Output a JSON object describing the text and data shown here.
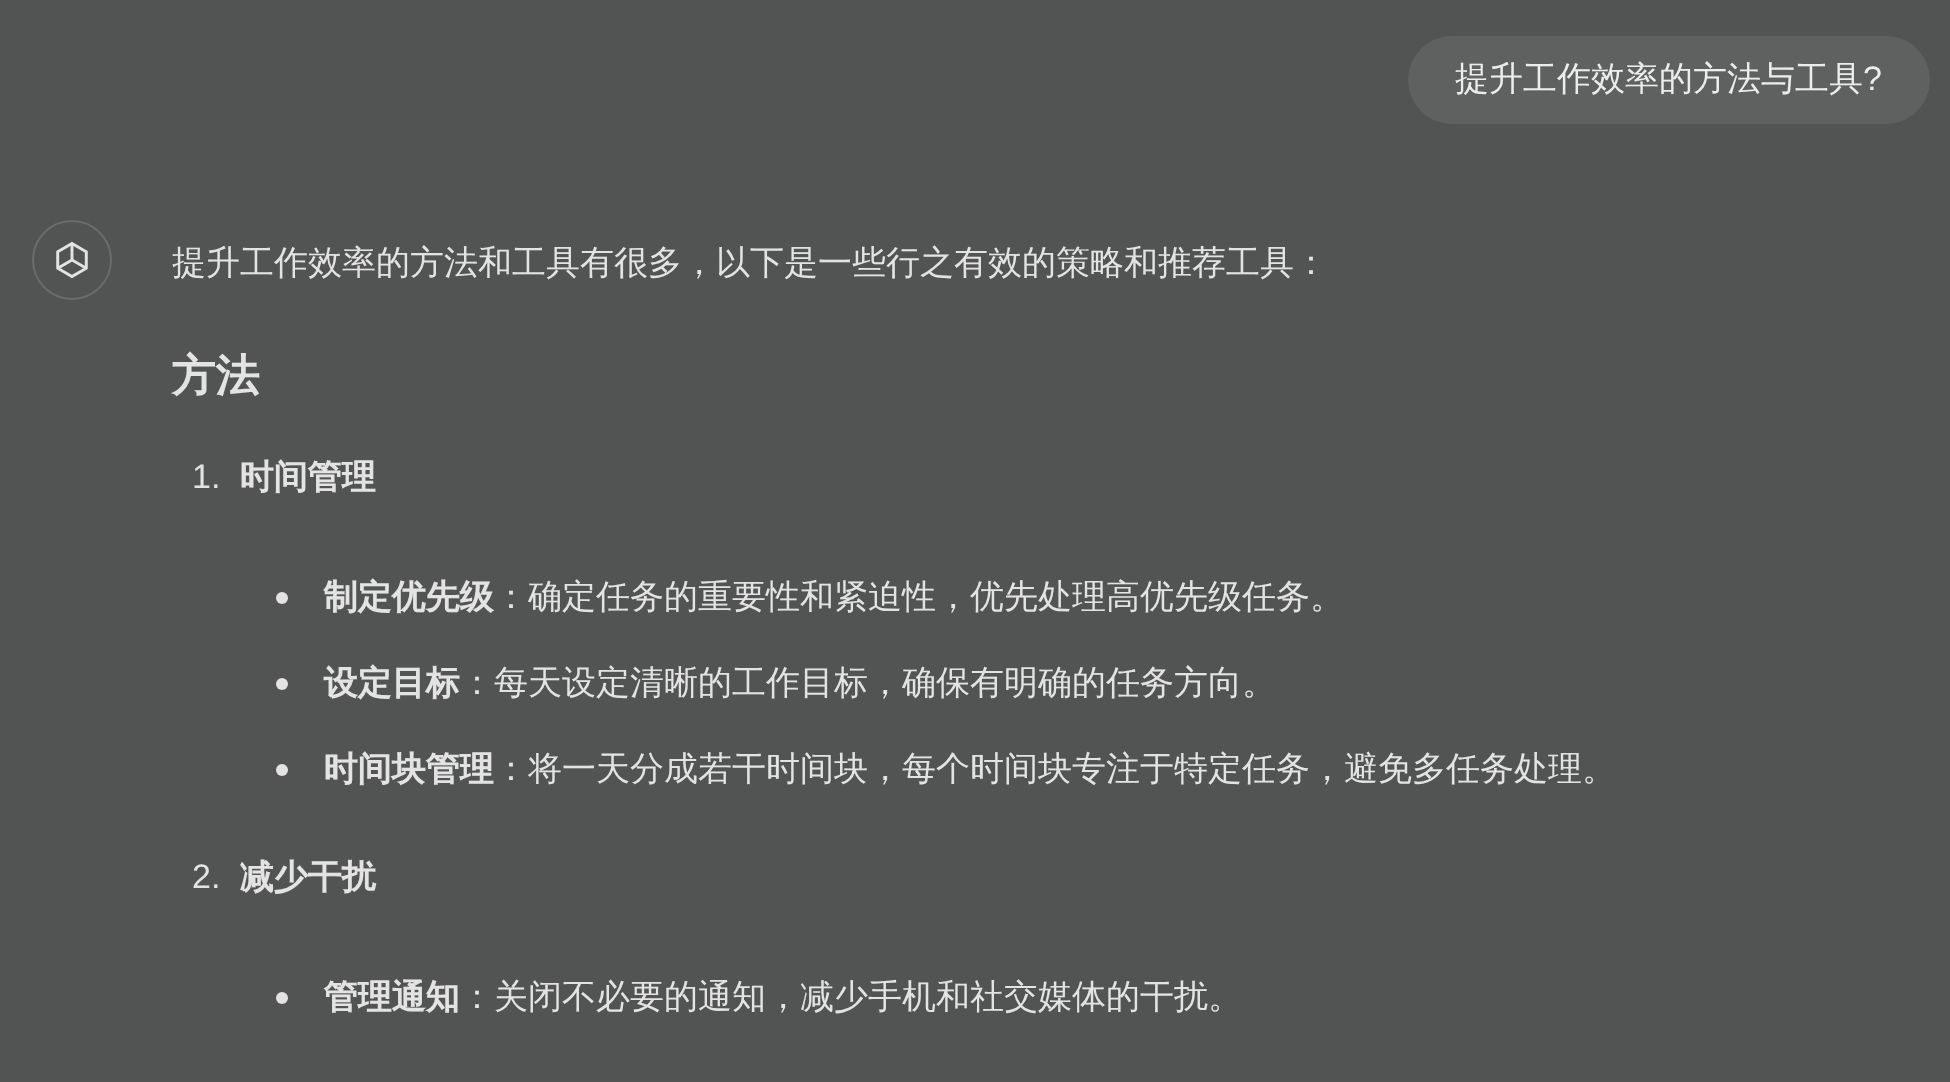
{
  "user_message": "提升工作效率的方法与工具?",
  "assistant": {
    "intro": "提升工作效率的方法和工具有很多，以下是一些行之有效的策略和推荐工具：",
    "sections": [
      {
        "heading": "方法",
        "items": [
          {
            "number": "1.",
            "title": "时间管理",
            "bullets": [
              "**制定优先级**：确定任务的重要性和紧迫性，优先处理高优先级任务。",
              "**设定目标**：每天设定清晰的工作目标，确保有明确的任务方向。",
              "**时间块管理**：将一天分成若干时间块，每个时间块专注于特定任务，避免多任务处理。"
            ]
          },
          {
            "number": "2.",
            "title": "减少干扰",
            "bullets": [
              "**管理通知**：关闭不必要的通知，减少手机和社交媒体的干扰。"
            ]
          }
        ]
      }
    ]
  }
}
